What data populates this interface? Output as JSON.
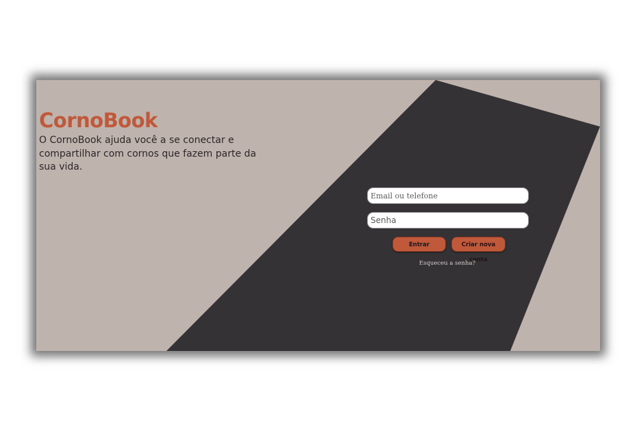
{
  "brand": {
    "name": "CornoBook",
    "tagline": "O CornoBook ajuda você a se conectar e compartilhar com cornos que fazem parte da sua vida."
  },
  "login": {
    "email_placeholder": "Email ou telefone",
    "password_placeholder": "Senha",
    "login_button": "Entrar",
    "create_account_button": "Criar nova conta",
    "forgot_password": "Esqueceu a senha?"
  },
  "colors": {
    "background": "#bfb3ad",
    "panel": "#353236",
    "accent": "#c0583a"
  }
}
